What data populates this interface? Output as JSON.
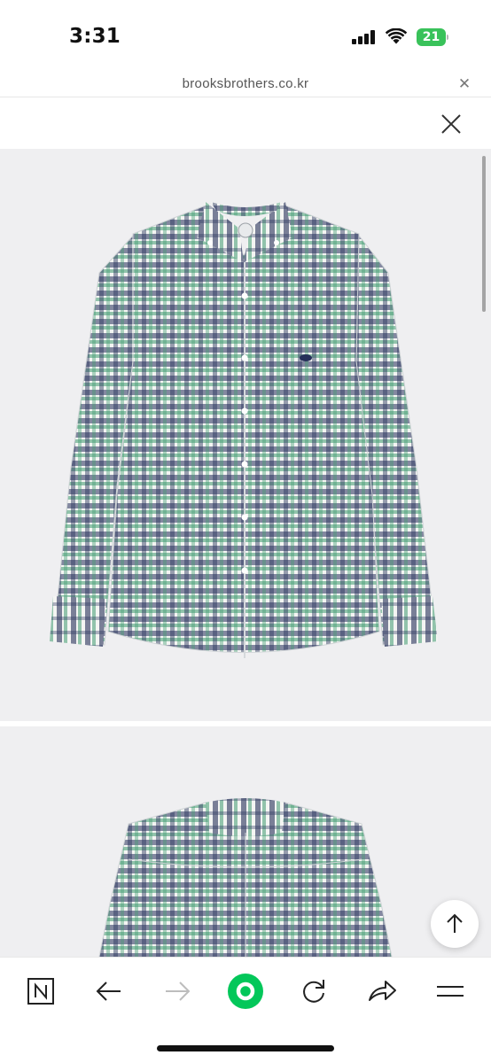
{
  "status_bar": {
    "time": "3:31",
    "battery_level": "21"
  },
  "url_bar": {
    "domain": "brooksbrothers.co.kr"
  },
  "product_images": {
    "colors": {
      "white": "#f4f5f3",
      "navy": "#26305a",
      "green": "#3f9a6e",
      "background": "#efeff1"
    }
  },
  "toolbar": {
    "items": [
      "naver-home",
      "back",
      "forward",
      "green-dot",
      "reload",
      "share",
      "menu"
    ],
    "accent": "#03c75a"
  }
}
